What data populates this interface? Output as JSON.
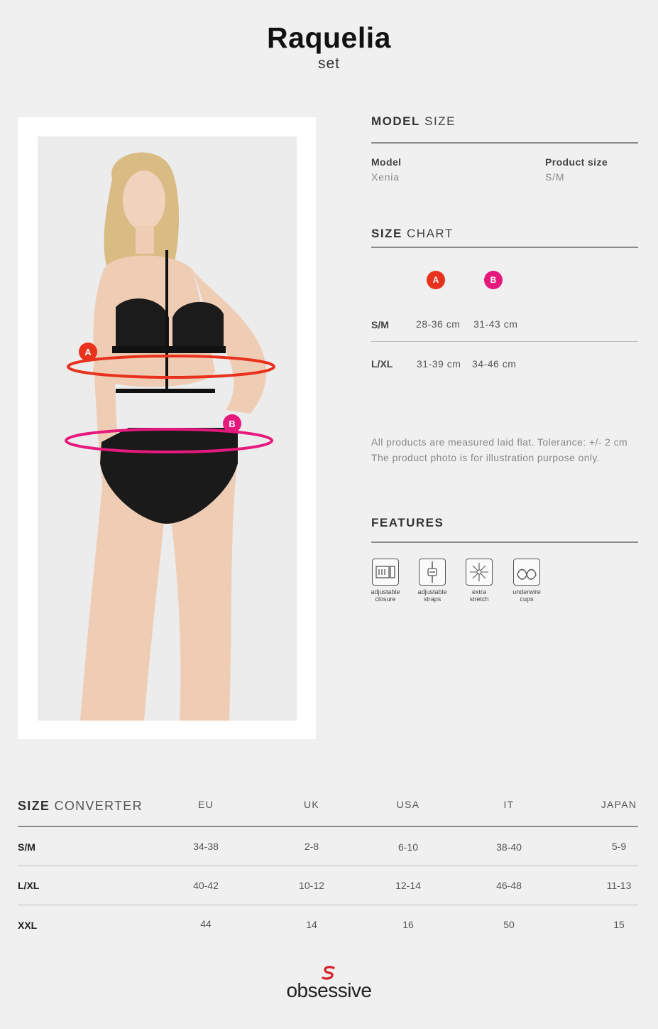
{
  "header": {
    "title": "Raquelia",
    "subtitle": "set"
  },
  "model_size": {
    "heading_bold": "MODEL",
    "heading_light": "SIZE",
    "model_label": "Model",
    "model_value": "Xenia",
    "product_label": "Product size",
    "product_value": "S/M"
  },
  "size_chart": {
    "heading_bold": "SIZE",
    "heading_light": "CHART",
    "badge_a": "A",
    "badge_b": "B",
    "rows": [
      {
        "size": "S/M",
        "a": "28-36 cm",
        "b": "31-43 cm"
      },
      {
        "size": "L/XL",
        "a": "31-39 cm",
        "b": "34-46 cm"
      }
    ],
    "note_line1": "All products are measured laid flat. Tolerance: +/- 2 cm",
    "note_line2": "The product photo is for illustration purpose only."
  },
  "features": {
    "heading": "FEATURES",
    "items": [
      {
        "icon": "adjustable-closure-icon",
        "line1": "adjustable",
        "line2": "closure"
      },
      {
        "icon": "adjustable-straps-icon",
        "line1": "adjustable",
        "line2": "straps"
      },
      {
        "icon": "extra-stretch-icon",
        "line1": "extra",
        "line2": "stretch"
      },
      {
        "icon": "underwire-cups-icon",
        "line1": "underwire",
        "line2": "cups"
      }
    ]
  },
  "photo": {
    "marker_a": "A",
    "marker_b": "B"
  },
  "converter": {
    "heading_bold": "SIZE",
    "heading_light": "CONVERTER",
    "columns": [
      "EU",
      "UK",
      "USA",
      "IT",
      "JAPAN"
    ],
    "rows": [
      {
        "size": "S/M",
        "values": [
          "34-38",
          "2-8",
          "6-10",
          "38-40",
          "5-9"
        ]
      },
      {
        "size": "L/XL",
        "values": [
          "40-42",
          "10-12",
          "12-14",
          "46-48",
          "11-13"
        ]
      },
      {
        "size": "XXL",
        "values": [
          "44",
          "14",
          "16",
          "50",
          "15"
        ]
      }
    ]
  },
  "brand": {
    "name": "obsessive"
  },
  "colors": {
    "badge_a": "#e8321e",
    "badge_b": "#e6197d",
    "background": "#f0f0f0"
  }
}
